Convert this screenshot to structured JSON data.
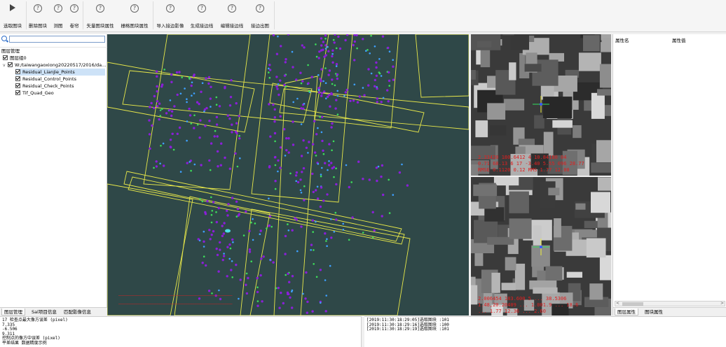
{
  "toolbar": {
    "buttons": [
      {
        "label": "选取图块",
        "icon": "cursor-arrow-icon"
      },
      {
        "label": "删除图块",
        "icon": "help-circle-icon"
      },
      {
        "label": "测图",
        "icon": "help-circle-icon"
      },
      {
        "label": "卷帘",
        "icon": "help-circle-icon"
      },
      {
        "label": "矢量图块属性",
        "icon": "help-circle-icon"
      },
      {
        "label": "栅格图块属性",
        "icon": "help-circle-icon"
      },
      {
        "label": "导入接边影像",
        "icon": "help-circle-icon"
      },
      {
        "label": "生成接边线",
        "icon": "help-circle-icon"
      },
      {
        "label": "编辑接边线",
        "icon": "help-circle-icon"
      },
      {
        "label": "接边出图",
        "icon": "help-circle-icon"
      }
    ]
  },
  "layers": {
    "search_value": "",
    "root": "图层管理",
    "nodes": [
      {
        "label": "图层组0",
        "checked": true
      },
      {
        "label": "W:/taiwangaoxiong20220517/2016/da...",
        "checked": true
      },
      {
        "label": "Residual_LianJie_Points",
        "checked": true
      },
      {
        "label": "Residual_Control_Points",
        "checked": true
      },
      {
        "label": "Residual_Check_Points",
        "checked": true
      },
      {
        "label": "Tif_Quad_Geo",
        "checked": true
      }
    ],
    "tabs": [
      "图层管理",
      "Sal项目信息",
      "匹配影像信息"
    ]
  },
  "map": {
    "background": "#2f4848",
    "footprint_color": "#e8e84a",
    "point_colors": {
      "tie": "#8a1fd8",
      "control": "#3ddc5a",
      "check": "#3ea0ff"
    }
  },
  "images": {
    "top_readout": [
      "2.33420 180.6412 4 10.84180 04",
      "0.71 68.13 6 17 -3.40 5.55 096 28.77",
      "RMSE 0.1120 0.12 RMS 1.77 12.00"
    ],
    "bottom_readout": [
      "2.006454 183.600 5 ... 38.5306",
      "1.48,20.20409 ... 1.001.9 ... 18.6",
      "... 1.77 12.36 ... 2.60"
    ]
  },
  "properties": {
    "col_name": "属性名",
    "col_value": "属性值",
    "scroll_left": "<",
    "scroll_right": ">",
    "tabs": [
      "图层属性",
      "图块属性"
    ]
  },
  "console_left": {
    "lines": [
      "17 检查点最大像方误差 (pixel)",
      "7.335",
      "-6.506",
      "9.311",
      "   控制点的像方中误差 (pixel)",
      "平差结果 数据精度示例"
    ]
  },
  "console_right": {
    "lines": [
      "[2019:11:30:18:29:05]选取图块 :101",
      "[2019:11:30:18:29:16]选取图块 :100",
      "[2019:11:30:18:29:19]选取图块 :101"
    ]
  }
}
